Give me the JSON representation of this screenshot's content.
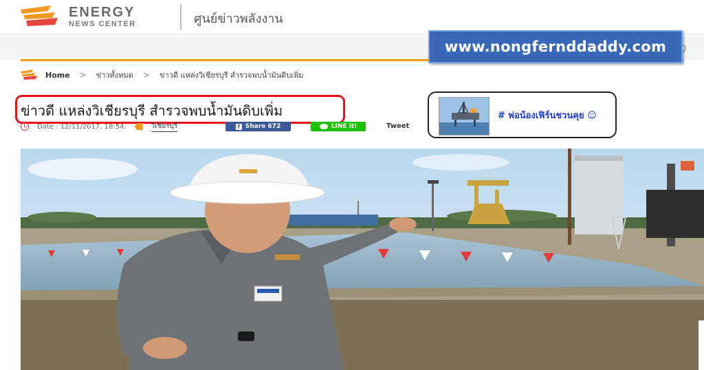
{
  "header": {
    "logo_title": "ENERGY",
    "logo_subtitle": "NEWS CENTER",
    "site_name_th": "ศูนย์ข่าวพลังงาน",
    "brand_colors": {
      "orange": "#f39a1c",
      "red": "#e8453c",
      "gray": "#6a6a6a"
    }
  },
  "watermark": {
    "text": "www.nongfernddaddy.com",
    "bg_color": "#3a68b8"
  },
  "nav": {
    "search_icon": "search-icon",
    "accent_color": "#f39a1c"
  },
  "breadcrumb": {
    "home": "Home",
    "items": [
      "ข่าวทั้งหมด",
      "ข่าวดี แหล่งวิเชียรบุรี สำรวจพบน้ำมันดิบเพิ่ม"
    ]
  },
  "article": {
    "title": "ข่าวดี แหล่งวิเชียรบุรี สำรวจพบน้ำมันดิบเพิ่ม",
    "date": "Date : 12/11/2017, 18:54.",
    "category": "วิเชียรบุรี",
    "share_facebook": "Share 672",
    "share_line": "LINE it!",
    "tweet": "Tweet",
    "highlight_color": "#e8101a"
  },
  "promo": {
    "text": "# พ่อน้องเฟิร์นชวนคุย",
    "emoji": "☺"
  },
  "photo": {
    "icon": "photo-oil-field-image"
  }
}
